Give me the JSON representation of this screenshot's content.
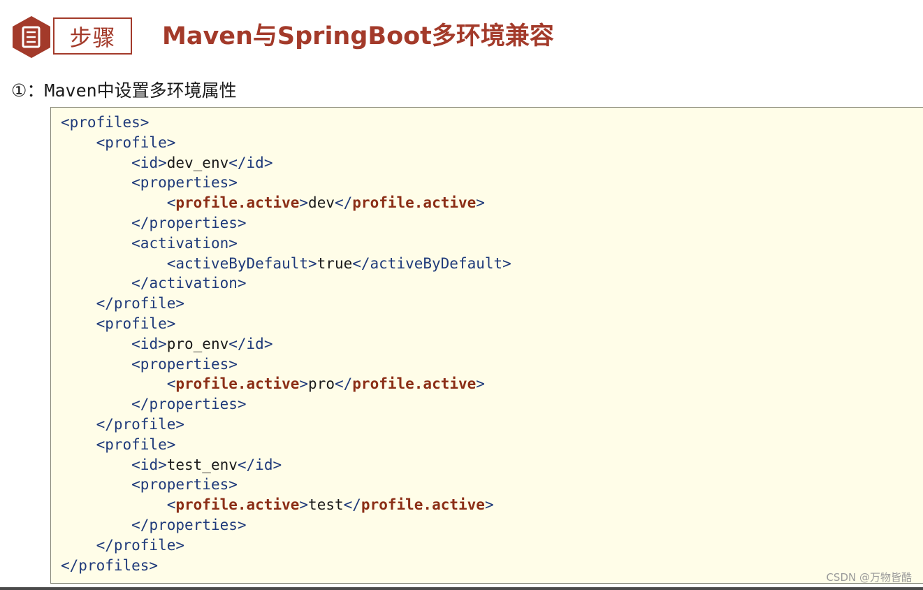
{
  "header": {
    "step_label": "步骤",
    "title": "Maven与SpringBoot多环境兼容"
  },
  "section": {
    "heading": "①：Maven中设置多环境属性"
  },
  "code": {
    "lines": [
      {
        "indent": 0,
        "parts": [
          {
            "c": "tag",
            "t": "<profiles>"
          }
        ]
      },
      {
        "indent": 1,
        "parts": [
          {
            "c": "tag",
            "t": "<profile>"
          }
        ]
      },
      {
        "indent": 2,
        "parts": [
          {
            "c": "tag",
            "t": "<id>"
          },
          {
            "c": "txt",
            "t": "dev_env"
          },
          {
            "c": "tag",
            "t": "</id>"
          }
        ]
      },
      {
        "indent": 2,
        "parts": [
          {
            "c": "tag",
            "t": "<properties>"
          }
        ]
      },
      {
        "indent": 3,
        "parts": [
          {
            "c": "tag",
            "t": "<"
          },
          {
            "c": "kw",
            "t": "profile.active"
          },
          {
            "c": "tag",
            "t": ">"
          },
          {
            "c": "txt",
            "t": "dev"
          },
          {
            "c": "tag",
            "t": "</"
          },
          {
            "c": "kw",
            "t": "profile.active"
          },
          {
            "c": "tag",
            "t": ">"
          }
        ]
      },
      {
        "indent": 2,
        "parts": [
          {
            "c": "tag",
            "t": "</properties>"
          }
        ]
      },
      {
        "indent": 2,
        "parts": [
          {
            "c": "tag",
            "t": "<activation>"
          }
        ]
      },
      {
        "indent": 3,
        "parts": [
          {
            "c": "tag",
            "t": "<activeByDefault>"
          },
          {
            "c": "txt",
            "t": "true"
          },
          {
            "c": "tag",
            "t": "</activeByDefault>"
          }
        ]
      },
      {
        "indent": 2,
        "parts": [
          {
            "c": "tag",
            "t": "</activation>"
          }
        ]
      },
      {
        "indent": 1,
        "parts": [
          {
            "c": "tag",
            "t": "</profile>"
          }
        ]
      },
      {
        "indent": 1,
        "parts": [
          {
            "c": "tag",
            "t": "<profile>"
          }
        ]
      },
      {
        "indent": 2,
        "parts": [
          {
            "c": "tag",
            "t": "<id>"
          },
          {
            "c": "txt",
            "t": "pro_env"
          },
          {
            "c": "tag",
            "t": "</id>"
          }
        ]
      },
      {
        "indent": 2,
        "parts": [
          {
            "c": "tag",
            "t": "<properties>"
          }
        ]
      },
      {
        "indent": 3,
        "parts": [
          {
            "c": "tag",
            "t": "<"
          },
          {
            "c": "kw",
            "t": "profile.active"
          },
          {
            "c": "tag",
            "t": ">"
          },
          {
            "c": "txt",
            "t": "pro"
          },
          {
            "c": "tag",
            "t": "</"
          },
          {
            "c": "kw",
            "t": "profile.active"
          },
          {
            "c": "tag",
            "t": ">"
          }
        ]
      },
      {
        "indent": 2,
        "parts": [
          {
            "c": "tag",
            "t": "</properties>"
          }
        ]
      },
      {
        "indent": 1,
        "parts": [
          {
            "c": "tag",
            "t": "</profile>"
          }
        ]
      },
      {
        "indent": 1,
        "parts": [
          {
            "c": "tag",
            "t": "<profile>"
          }
        ]
      },
      {
        "indent": 2,
        "parts": [
          {
            "c": "tag",
            "t": "<id>"
          },
          {
            "c": "txt",
            "t": "test_env"
          },
          {
            "c": "tag",
            "t": "</id>"
          }
        ]
      },
      {
        "indent": 2,
        "parts": [
          {
            "c": "tag",
            "t": "<properties>"
          }
        ]
      },
      {
        "indent": 3,
        "parts": [
          {
            "c": "tag",
            "t": "<"
          },
          {
            "c": "kw",
            "t": "profile.active"
          },
          {
            "c": "tag",
            "t": ">"
          },
          {
            "c": "txt",
            "t": "test"
          },
          {
            "c": "tag",
            "t": "</"
          },
          {
            "c": "kw",
            "t": "profile.active"
          },
          {
            "c": "tag",
            "t": ">"
          }
        ]
      },
      {
        "indent": 2,
        "parts": [
          {
            "c": "tag",
            "t": "</properties>"
          }
        ]
      },
      {
        "indent": 1,
        "parts": [
          {
            "c": "tag",
            "t": "</profile>"
          }
        ]
      },
      {
        "indent": 0,
        "parts": [
          {
            "c": "tag",
            "t": "</profiles>"
          }
        ]
      }
    ]
  },
  "watermark": "CSDN @万物皆酷",
  "colors": {
    "brand": "#a33a2a",
    "tag": "#1f3a7a",
    "keyword": "#8b2e16",
    "code_background": "#fffde8"
  },
  "icons": {
    "step_icon": "document-icon"
  }
}
